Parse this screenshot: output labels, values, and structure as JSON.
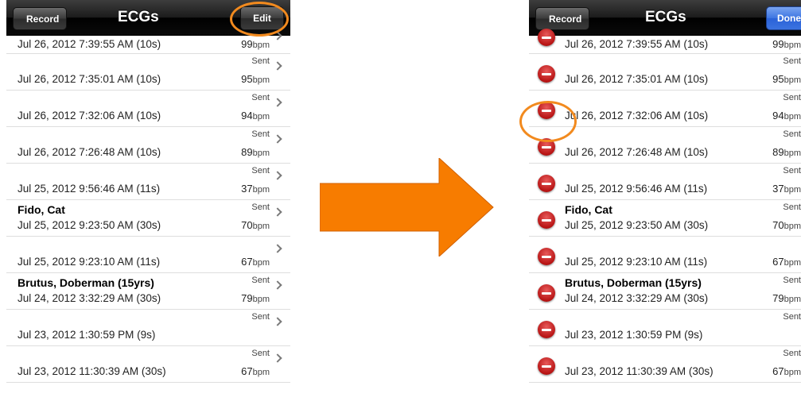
{
  "left": {
    "nav_title": "ECGs",
    "back_label": "Record",
    "edit_label": "Edit"
  },
  "right": {
    "nav_title": "ECGs",
    "back_label": "Record",
    "done_label": "Done"
  },
  "colors": {
    "highlight": "#f28a1e",
    "arrow": "#f77c00",
    "delete": "#c41a1a",
    "done_button": "#3d75e2"
  },
  "bpm_unit": "bpm",
  "rows": [
    {
      "name": "",
      "date": "Jul 26, 2012 7:39:55 AM  (10s)",
      "sent": "",
      "bpm": "99"
    },
    {
      "name": "",
      "date": "Jul 26, 2012 7:35:01 AM  (10s)",
      "sent": "Sent",
      "bpm": "95"
    },
    {
      "name": "",
      "date": "Jul 26, 2012 7:32:06 AM  (10s)",
      "sent": "Sent",
      "bpm": "94"
    },
    {
      "name": "",
      "date": "Jul 26, 2012 7:26:48 AM  (10s)",
      "sent": "Sent",
      "bpm": "89"
    },
    {
      "name": "",
      "date": "Jul 25, 2012 9:56:46 AM  (11s)",
      "sent": "Sent",
      "bpm": "37"
    },
    {
      "name": "Fido, Cat",
      "date": "Jul 25, 2012 9:23:50 AM  (30s)",
      "sent": "Sent",
      "bpm": "70"
    },
    {
      "name": "",
      "date": "Jul 25, 2012 9:23:10 AM  (11s)",
      "sent": "",
      "bpm": "67"
    },
    {
      "name": "Brutus, Doberman (15yrs)",
      "date": "Jul 24, 2012 3:32:29 AM  (30s)",
      "sent": "Sent",
      "bpm": "79"
    },
    {
      "name": "",
      "date": "Jul 23, 2012 1:30:59 PM  (9s)",
      "sent": "Sent",
      "bpm": ""
    },
    {
      "name": "",
      "date": "Jul 23, 2012 11:30:39 AM  (30s)",
      "sent": "Sent",
      "bpm": "67"
    }
  ]
}
